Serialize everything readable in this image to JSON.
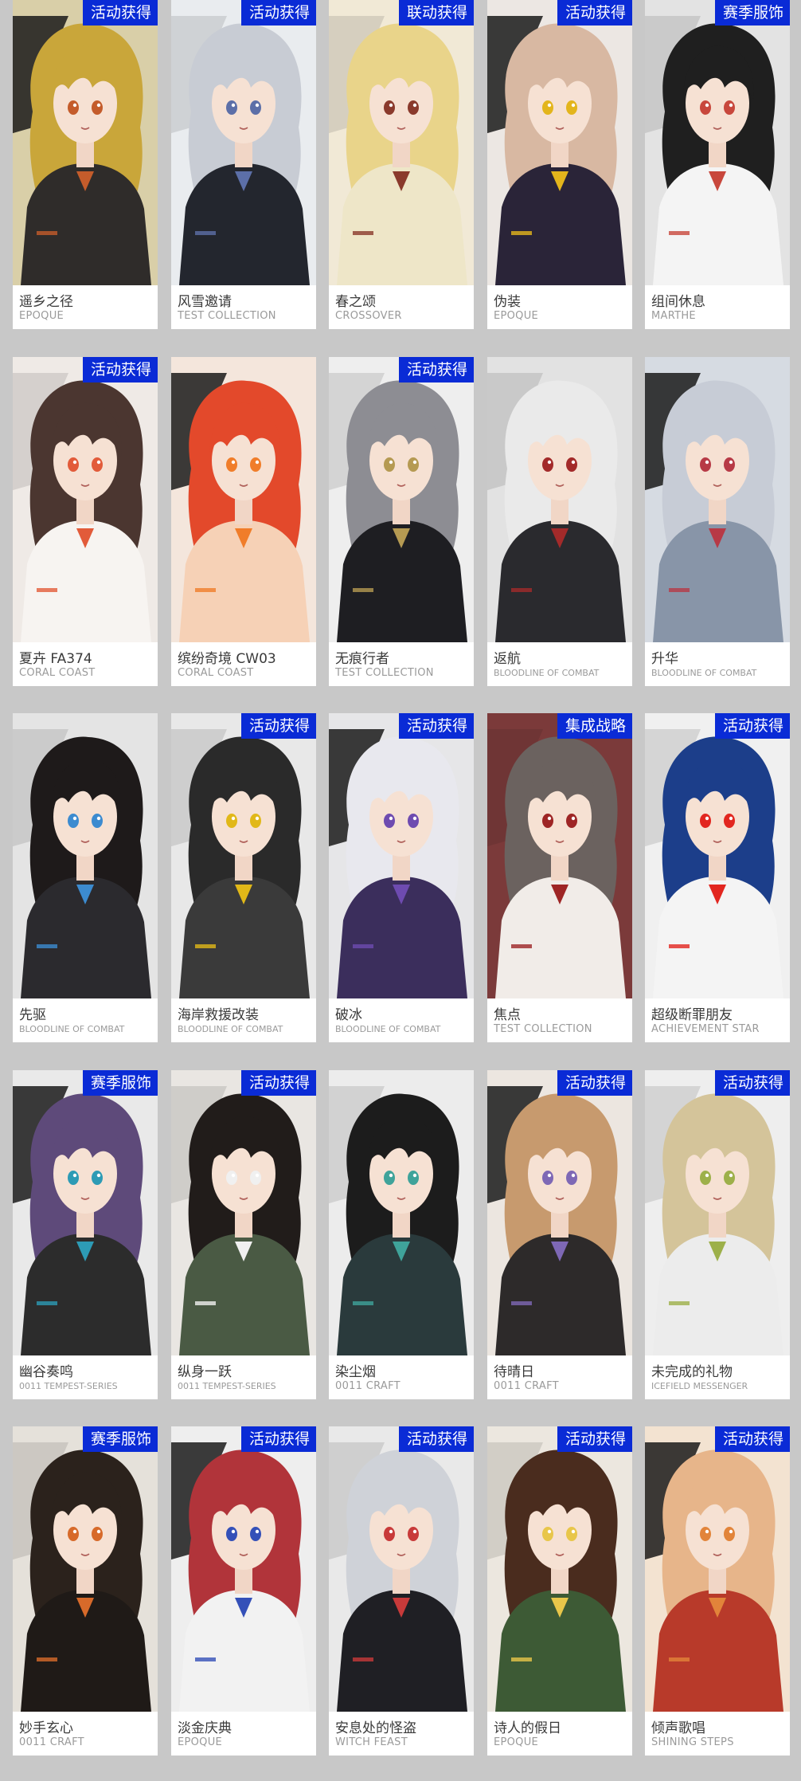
{
  "rows": [
    [
      {
        "name": "遥乡之径",
        "series": "EPOQUE",
        "badge": "活动获得",
        "colors": {
          "bg": "#d9cfa8",
          "hair": "#c9a63a",
          "outfit": "#2f2c2a",
          "accent": "#c45c2b"
        }
      },
      {
        "name": "风雪邀请",
        "series": "TEST COLLECTION",
        "badge": "活动获得",
        "colors": {
          "bg": "#e9ecef",
          "hair": "#c8ccd4",
          "outfit": "#23262e",
          "accent": "#5c6fa8"
        }
      },
      {
        "name": "春之颂",
        "series": "CROSSOVER",
        "badge": "联动获得",
        "colors": {
          "bg": "#f1e9d6",
          "hair": "#e9d48a",
          "outfit": "#eee6c8",
          "accent": "#8a3a2c"
        }
      },
      {
        "name": "伪装",
        "series": "EPOQUE",
        "badge": "活动获得",
        "colors": {
          "bg": "#ece7e3",
          "hair": "#d8b8a2",
          "outfit": "#2a2438",
          "accent": "#e3b51c"
        }
      },
      {
        "name": "组间休息",
        "series": "MARTHE",
        "badge": "赛季服饰",
        "colors": {
          "bg": "#e3e3e3",
          "hair": "#1f1f1f",
          "outfit": "#f4f4f4",
          "accent": "#c8473c"
        }
      }
    ],
    [
      {
        "name": "夏卉 FA374",
        "series": "CORAL COAST",
        "badge": "活动获得",
        "colors": {
          "bg": "#efeae6",
          "hair": "#4b3630",
          "outfit": "#f7f4f1",
          "accent": "#e25b3a"
        }
      },
      {
        "name": "缤纷奇境 CW03",
        "series": "CORAL COAST",
        "badge": "",
        "colors": {
          "bg": "#f4e6dc",
          "hair": "#e3492b",
          "outfit": "#f6d1b6",
          "accent": "#f07d2a"
        }
      },
      {
        "name": "无痕行者",
        "series": "TEST COLLECTION",
        "badge": "活动获得",
        "colors": {
          "bg": "#eeeeee",
          "hair": "#8d8d93",
          "outfit": "#1e1e22",
          "accent": "#b59a52"
        }
      },
      {
        "name": "返航",
        "series": "BLOODLINE OF COMBAT",
        "badge": "",
        "colors": {
          "bg": "#e2e2e2",
          "hair": "#eaeaea",
          "outfit": "#2a2a2e",
          "accent": "#a32a2a"
        }
      },
      {
        "name": "升华",
        "series": "BLOODLINE OF COMBAT",
        "badge": "",
        "colors": {
          "bg": "#d6dbe2",
          "hair": "#c7ccd6",
          "outfit": "#8895a8",
          "accent": "#b73a46"
        }
      }
    ],
    [
      {
        "name": "先驱",
        "series": "BLOODLINE OF COMBAT",
        "badge": "",
        "colors": {
          "bg": "#e4e4e4",
          "hair": "#1e1a1a",
          "outfit": "#2b2a2e",
          "accent": "#3c8bd0"
        }
      },
      {
        "name": "海岸救援改装",
        "series": "BLOODLINE OF COMBAT",
        "badge": "活动获得",
        "colors": {
          "bg": "#e8e8e8",
          "hair": "#2a2a2a",
          "outfit": "#3a3a3a",
          "accent": "#e1b818"
        }
      },
      {
        "name": "破冰",
        "series": "BLOODLINE OF COMBAT",
        "badge": "活动获得",
        "colors": {
          "bg": "#e6e6e8",
          "hair": "#e8e8ee",
          "outfit": "#3b2e5c",
          "accent": "#6e4bb0"
        }
      },
      {
        "name": "焦点",
        "series": "TEST COLLECTION",
        "badge": "集成战略",
        "colors": {
          "bg": "#7b3a3a",
          "hair": "#6b625f",
          "outfit": "#f1ece8",
          "accent": "#9e2525"
        }
      },
      {
        "name": "超级断罪朋友",
        "series": "ACHIEVEMENT STAR",
        "badge": "活动获得",
        "colors": {
          "bg": "#f0f0f0",
          "hair": "#1c3e8a",
          "outfit": "#f4f4f4",
          "accent": "#e2261f"
        }
      }
    ],
    [
      {
        "name": "幽谷奏鸣",
        "series": "0011 TEMPEST-SERIES",
        "badge": "赛季服饰",
        "colors": {
          "bg": "#e9e9e9",
          "hair": "#5e4a7a",
          "outfit": "#2c2c2c",
          "accent": "#2d9bb5"
        }
      },
      {
        "name": "纵身一跃",
        "series": "0011 TEMPEST-SERIES",
        "badge": "活动获得",
        "colors": {
          "bg": "#e9e6e2",
          "hair": "#211c1a",
          "outfit": "#4a5a44",
          "accent": "#f0f0f0"
        }
      },
      {
        "name": "染尘烟",
        "series": "0011 CRAFT",
        "badge": "",
        "colors": {
          "bg": "#ececec",
          "hair": "#1c1c1c",
          "outfit": "#2a3a3c",
          "accent": "#3fa39a"
        }
      },
      {
        "name": "待晴日",
        "series": "0011 CRAFT",
        "badge": "活动获得",
        "colors": {
          "bg": "#ece6e0",
          "hair": "#c79a6e",
          "outfit": "#2d2a2a",
          "accent": "#7e68b5"
        }
      },
      {
        "name": "未完成的礼物",
        "series": "ICEFIELD MESSENGER",
        "badge": "活动获得",
        "colors": {
          "bg": "#eeeeee",
          "hair": "#d4c49a",
          "outfit": "#ececec",
          "accent": "#9db04a"
        }
      }
    ],
    [
      {
        "name": "妙手玄心",
        "series": "0011 CRAFT",
        "badge": "赛季服饰",
        "colors": {
          "bg": "#e5e1da",
          "hair": "#2b221c",
          "outfit": "#1f1a17",
          "accent": "#d76a2a"
        }
      },
      {
        "name": "淡金庆典",
        "series": "EPOQUE",
        "badge": "活动获得",
        "colors": {
          "bg": "#eeeeee",
          "hair": "#b1343a",
          "outfit": "#f2f2f2",
          "accent": "#3450b8"
        }
      },
      {
        "name": "安息处的怪盗",
        "series": "WITCH FEAST",
        "badge": "活动获得",
        "colors": {
          "bg": "#e9e9e9",
          "hair": "#cfd2d8",
          "outfit": "#1f1f24",
          "accent": "#c83a3a"
        }
      },
      {
        "name": "诗人的假日",
        "series": "EPOQUE",
        "badge": "活动获得",
        "colors": {
          "bg": "#ece7df",
          "hair": "#4a2c1e",
          "outfit": "#3d5a35",
          "accent": "#e8c64a"
        }
      },
      {
        "name": "倾声歌唱",
        "series": "SHINING STEPS",
        "badge": "活动获得",
        "colors": {
          "bg": "#f3e3d1",
          "hair": "#e7b58a",
          "outfit": "#b83a2a",
          "accent": "#e2843a"
        }
      }
    ]
  ]
}
